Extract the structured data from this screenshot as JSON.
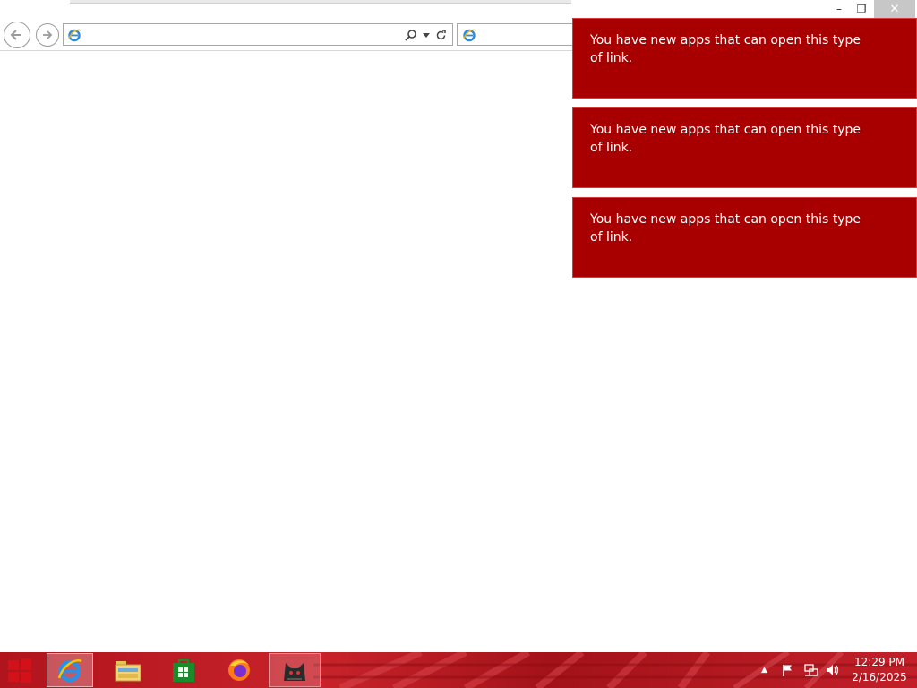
{
  "window": {
    "minimize_label": "–",
    "restore_label": "❐",
    "close_label": "✕"
  },
  "browser": {
    "back_glyph": "🡐",
    "forward_glyph": "🡒",
    "address_value": "",
    "tab_title": "",
    "search_icon": "search-icon",
    "dropdown_icon": "chevron-down-icon",
    "refresh_icon": "refresh-icon"
  },
  "notifications": [
    {
      "message": "You have new apps that can open this type of link."
    },
    {
      "message": "You have new apps that can open this type of link."
    },
    {
      "message": "You have new apps that can open this type of link."
    }
  ],
  "taskbar": {
    "pinned": [
      "windows-start",
      "internet-explorer",
      "file-explorer",
      "windows-store",
      "firefox",
      "cat-app"
    ],
    "tray_expand_glyph": "▲",
    "clock_time": "12:29 PM",
    "clock_date": "2/16/2025"
  },
  "colors": {
    "toast_bg": "#a80000",
    "taskbar_red": "#c8232b",
    "store_green": "#1a8a2a"
  }
}
